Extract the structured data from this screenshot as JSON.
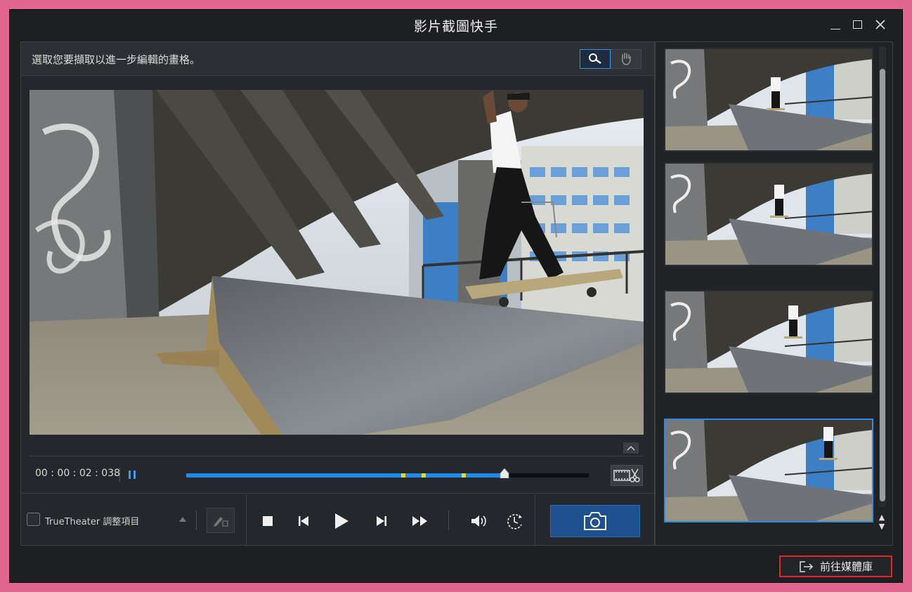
{
  "window": {
    "title": "影片截圖快手"
  },
  "instruction_bar": {
    "text": "選取您要擷取以進一步編輯的畫格。",
    "tools": [
      {
        "icon": "zoom-select-icon",
        "active": true
      },
      {
        "icon": "hand-pan-icon",
        "active": false
      }
    ]
  },
  "playback": {
    "timecode": "00 : 00 : 02 : 038",
    "progress_fraction": 0.79,
    "markers_fraction": [
      0.54,
      0.59,
      0.69
    ],
    "accent_color": "#1f8be6",
    "marker_color": "#e8d82a"
  },
  "truetheater": {
    "label": "TrueTheater 調整項目",
    "checked": false
  },
  "thumbnails": {
    "count": 4,
    "selected_index": 3
  },
  "footer": {
    "goto_label": "前往媒體庫"
  }
}
